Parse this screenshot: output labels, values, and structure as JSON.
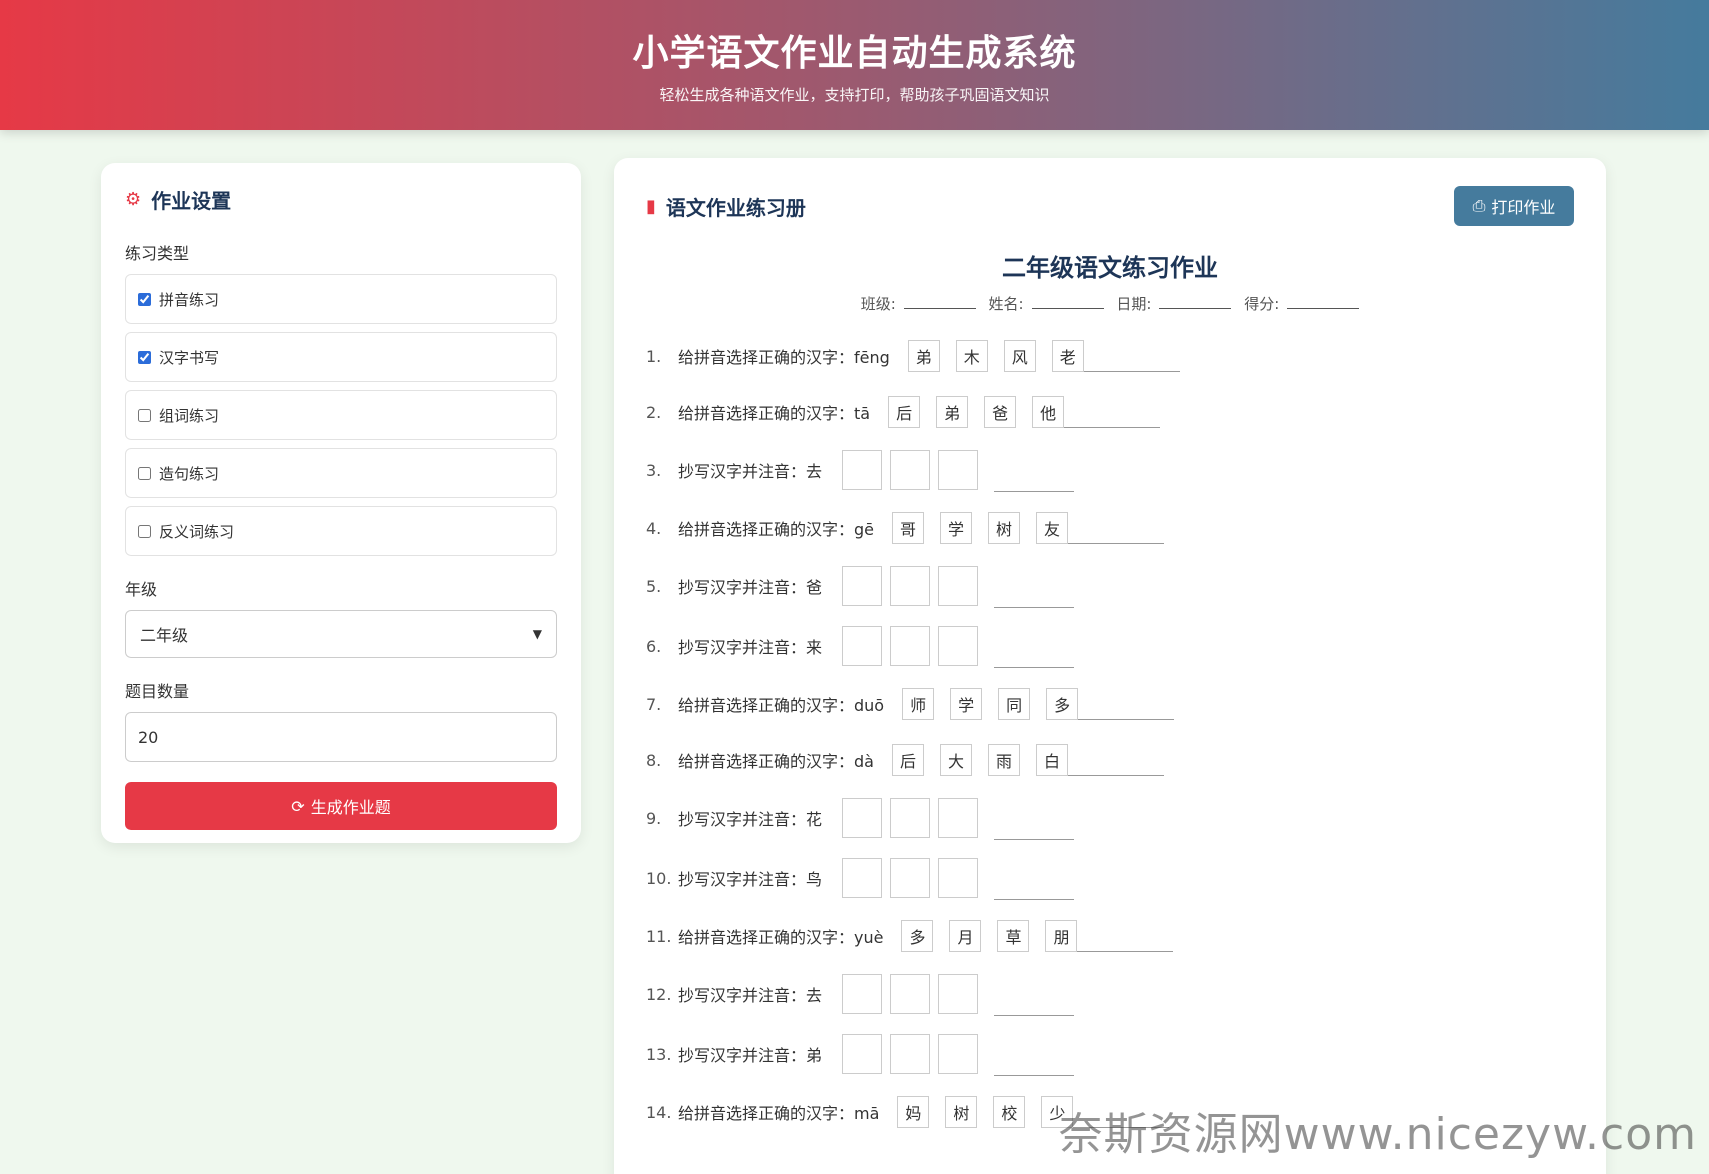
{
  "header": {
    "title": "小学语文作业自动生成系统",
    "subtitle": "轻松生成各种语文作业，支持打印，帮助孩子巩固语文知识"
  },
  "settings": {
    "title": "作业设置",
    "type_label": "练习类型",
    "types": [
      {
        "label": "拼音练习",
        "checked": true
      },
      {
        "label": "汉字书写",
        "checked": true
      },
      {
        "label": "组词练习",
        "checked": false
      },
      {
        "label": "造句练习",
        "checked": false
      },
      {
        "label": "反义词练习",
        "checked": false
      }
    ],
    "grade_label": "年级",
    "grade_value": "二年级",
    "count_label": "题目数量",
    "count_value": "20",
    "generate_label": "生成作业题"
  },
  "workbook": {
    "title": "语文作业练习册",
    "print_label": "打印作业",
    "sheet_title": "二年级语文练习作业",
    "info": {
      "class": "班级:",
      "name": "姓名:",
      "date": "日期:",
      "score": "得分:"
    },
    "questions": [
      {
        "num": "1.",
        "type": "pinyin",
        "text": "给拼音选择正确的汉字：fēng",
        "options": [
          "弟",
          "木",
          "风",
          "老"
        ]
      },
      {
        "num": "2.",
        "type": "pinyin",
        "text": "给拼音选择正确的汉字：tā",
        "options": [
          "后",
          "弟",
          "爸",
          "他"
        ]
      },
      {
        "num": "3.",
        "type": "copy",
        "text": "抄写汉字并注音：去"
      },
      {
        "num": "4.",
        "type": "pinyin",
        "text": "给拼音选择正确的汉字：gē",
        "options": [
          "哥",
          "学",
          "树",
          "友"
        ]
      },
      {
        "num": "5.",
        "type": "copy",
        "text": "抄写汉字并注音：爸"
      },
      {
        "num": "6.",
        "type": "copy",
        "text": "抄写汉字并注音：来"
      },
      {
        "num": "7.",
        "type": "pinyin",
        "text": "给拼音选择正确的汉字：duō",
        "options": [
          "师",
          "学",
          "同",
          "多"
        ]
      },
      {
        "num": "8.",
        "type": "pinyin",
        "text": "给拼音选择正确的汉字：dà",
        "options": [
          "后",
          "大",
          "雨",
          "白"
        ]
      },
      {
        "num": "9.",
        "type": "copy",
        "text": "抄写汉字并注音：花"
      },
      {
        "num": "10.",
        "type": "copy",
        "text": "抄写汉字并注音：鸟"
      },
      {
        "num": "11.",
        "type": "pinyin",
        "text": "给拼音选择正确的汉字：yuè",
        "options": [
          "多",
          "月",
          "草",
          "朋"
        ]
      },
      {
        "num": "12.",
        "type": "copy",
        "text": "抄写汉字并注音：去"
      },
      {
        "num": "13.",
        "type": "copy",
        "text": "抄写汉字并注音：弟"
      },
      {
        "num": "14.",
        "type": "pinyin",
        "text": "给拼音选择正确的汉字：mā",
        "options": [
          "妈",
          "树",
          "校",
          "少"
        ]
      }
    ]
  },
  "watermark": "奈斯资源网www.nicezyw.com",
  "colors": {
    "primary": "#e63946",
    "secondary": "#457b9d",
    "title": "#1d3557",
    "background": "#eff8ee"
  }
}
